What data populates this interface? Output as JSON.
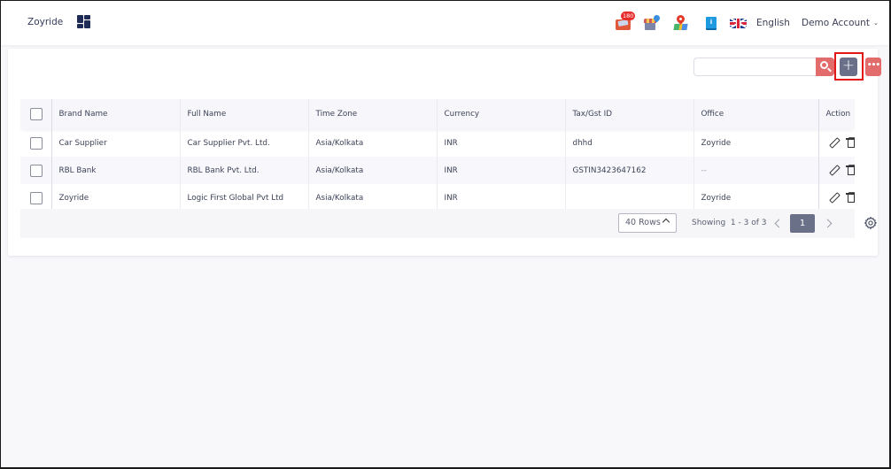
{
  "header": {
    "brand": "Zoyride",
    "notifications_count": "180",
    "book_glyph": "i",
    "language": "English",
    "account": "Demo Account",
    "account_chevron": "⌄",
    "icons": [
      "dashboard-grid-icon",
      "mail-notification-icon",
      "store-location-icon",
      "map-pin-icon",
      "guide-book-icon",
      "uk-flag-icon",
      "chevron-down-icon"
    ]
  },
  "toolbar": {
    "search_value": "",
    "search_placeholder": "",
    "add_label": "+",
    "more_label": "•••",
    "accent_color": "#e26b6b",
    "add_button_color": "#6a7089",
    "highlight_color": "#e01818"
  },
  "table": {
    "columns": [
      "Brand Name",
      "Full Name",
      "Time Zone",
      "Currency",
      "Tax/Gst ID",
      "Office",
      "Action"
    ],
    "rows": [
      {
        "brand_name": "Car Supplier",
        "full_name": "Car Supplier Pvt. Ltd.",
        "time_zone": "Asia/Kolkata",
        "currency": "INR",
        "tax_id": "dhhd",
        "office": "Zoyride"
      },
      {
        "brand_name": "RBL Bank",
        "full_name": "RBL Bank Pvt. Ltd.",
        "time_zone": "Asia/Kolkata",
        "currency": "INR",
        "tax_id": "GSTIN3423647162",
        "office": "--"
      },
      {
        "brand_name": "Zoyride",
        "full_name": "Logic First Global Pvt Ltd",
        "time_zone": "Asia/Kolkata",
        "currency": "INR",
        "tax_id": "",
        "office": "Zoyride"
      }
    ]
  },
  "pagination": {
    "rows_per_page": "40 Rows",
    "showing": "Showing  1 - 3 of 3",
    "current_page": "1"
  }
}
